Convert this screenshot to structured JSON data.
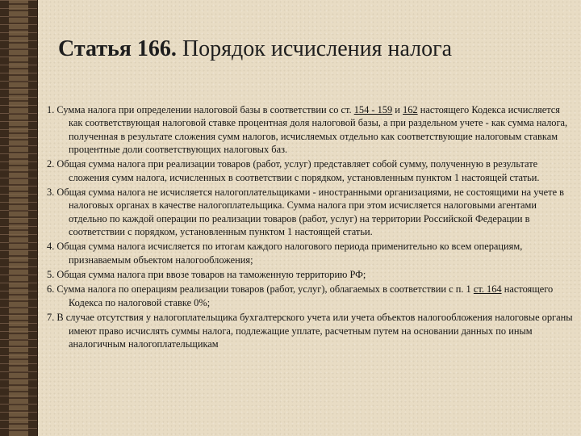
{
  "title": {
    "number": "Статья 166.",
    "text": "Порядок исчисления налога"
  },
  "items": [
    {
      "parts": [
        {
          "t": "1. Сумма налога при определении налоговой базы в соответствии со ст. "
        },
        {
          "t": "154 - 159",
          "link": true
        },
        {
          "t": " и "
        },
        {
          "t": "162",
          "link": true
        },
        {
          "t": " настоящего Кодекса исчисляется как соответствующая налоговой ставке процентная доля налоговой базы, а при раздельном учете - как сумма налога, полученная в результате сложения сумм налогов, исчисляемых отдельно как соответствующие налоговым ставкам процентные доли соответствующих налоговых баз."
        }
      ]
    },
    {
      "parts": [
        {
          "t": "2. Общая сумма налога при реализации товаров (работ, услуг) представляет собой сумму, полученную в результате сложения сумм налога, исчисленных в соответствии с порядком, установленным пунктом 1 настоящей статьи."
        }
      ]
    },
    {
      "parts": [
        {
          "t": "3. Общая сумма налога не исчисляется налогоплательщиками - иностранными организациями, не состоящими на учете в налоговых органах в качестве налогоплательщика. Сумма налога при этом исчисляется налоговыми агентами отдельно по каждой операции по реализации товаров (работ, услуг) на территории Российской Федерации в соответствии с порядком, установленным пунктом 1 настоящей статьи."
        }
      ]
    },
    {
      "parts": [
        {
          "t": "4. Общая сумма налога исчисляется по итогам каждого налогового периода применительно ко всем операциям, признаваемым объектом налогообложения;"
        }
      ]
    },
    {
      "parts": [
        {
          "t": "5. Общая сумма налога при ввозе товаров на таможенную территорию РФ;"
        }
      ]
    },
    {
      "parts": [
        {
          "t": "6. Сумма налога по операциям реализации товаров (работ, услуг), облагаемых в соответствии с п. 1 "
        },
        {
          "t": "ст. 164",
          "link": true
        },
        {
          "t": " настоящего Кодекса по налоговой ставке 0%;"
        }
      ]
    },
    {
      "parts": [
        {
          "t": "7. В случае отсутствия у налогоплательщика бухгалтерского учета или учета объектов налогообложения налоговые органы имеют право исчислять суммы налога, подлежащие уплате, расчетным путем на основании данных по иным аналогичным налогоплательщикам"
        }
      ]
    }
  ]
}
